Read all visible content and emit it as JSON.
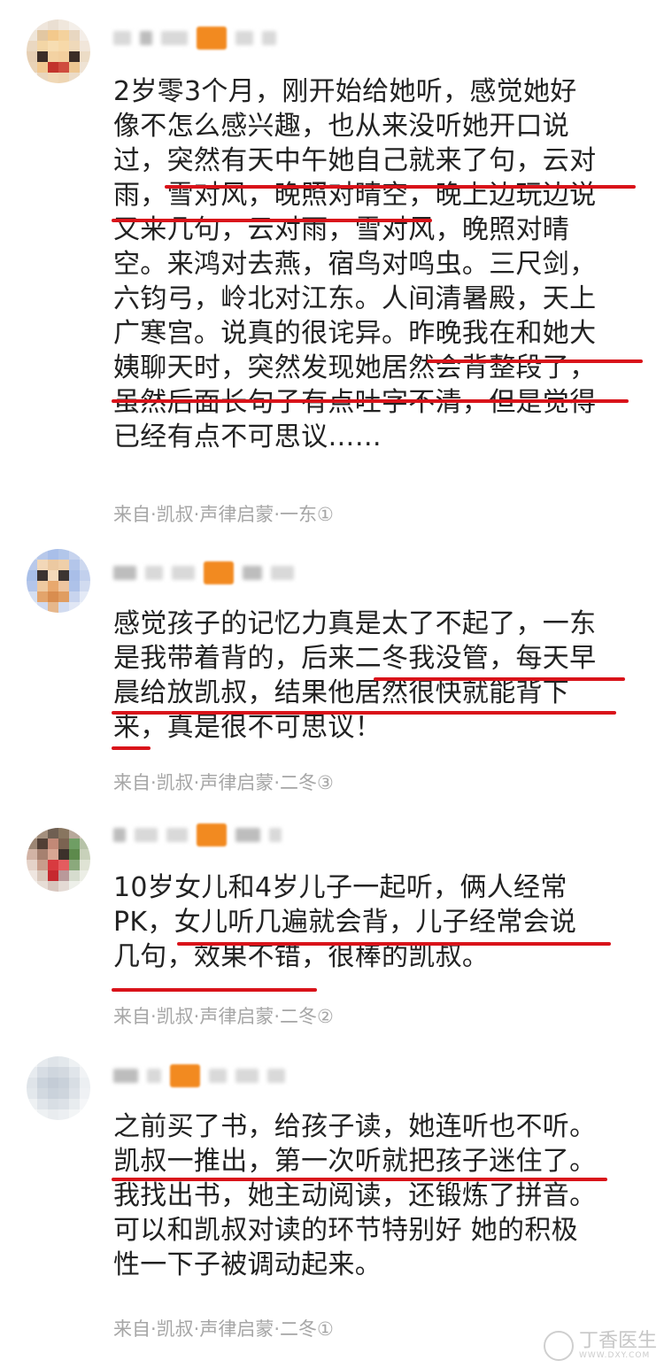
{
  "comments": [
    {
      "lines": [
        "2岁零3个月，刚开始给她听，感觉她好",
        "像不怎么感兴趣，也从来没听她开口说",
        "过，突然有天中午她自己就来了句，云对",
        "雨，雪对风，晚照对晴空，晚上边玩边说",
        "又来几句，云对雨，雪对风，晚照对晴",
        "空。来鸿对去燕，宿鸟对鸣虫。三尺剑，",
        "六钧弓，岭北对江东。人间清暑殿，天上",
        "广寒宫。说真的很诧异。昨晚我在和她大",
        "姨聊天时，突然发现她居然会背整段了，",
        "虽然后面长句子有点吐字不清，但是觉得",
        "已经有点不可思议……"
      ],
      "source": "来自·凯叔·声律启蒙·一东①"
    },
    {
      "lines": [
        "感觉孩子的记忆力真是太了不起了，一东",
        "是我带着背的，后来二冬我没管，每天早",
        "晨给放凯叔，结果他居然很快就能背下",
        "来，真是很不可思议！"
      ],
      "source": "来自·凯叔·声律启蒙·二冬③"
    },
    {
      "lines": [
        "10岁女儿和4岁儿子一起听，俩人经常",
        "PK，女儿听几遍就会背，儿子经常会说",
        "几句，效果不错，很棒的凯叔。"
      ],
      "source": "来自·凯叔·声律启蒙·二冬②"
    },
    {
      "lines": [
        "之前买了书，给孩子读，她连听也不听。",
        "凯叔一推出，第一次听就把孩子迷住了。",
        "我找出书，她主动阅读，还锻炼了拼音。",
        "可以和凯叔对读的环节特别好 她的积极",
        "性一下子被调动起来。"
      ],
      "source": "来自·凯叔·声律启蒙·二冬①"
    }
  ],
  "colors": {
    "underline": "#d9131a",
    "source_text": "#a6a6a6",
    "body_text": "#222222",
    "badge": "#f28a20"
  },
  "watermark": {
    "logo_icon": "dxy-logo-icon",
    "name": "丁香医生",
    "sub": "WWW.DXY.COM"
  }
}
